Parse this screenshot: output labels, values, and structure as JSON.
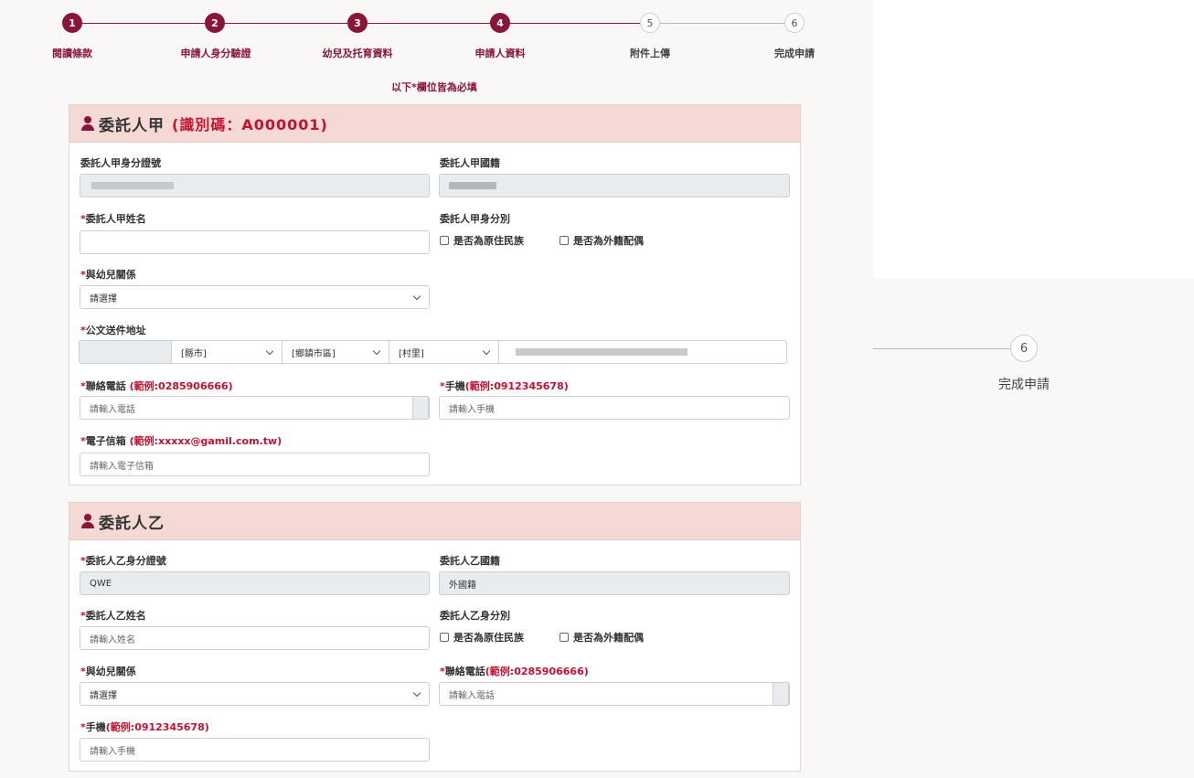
{
  "stepper": {
    "steps": [
      {
        "num": "1",
        "label": "閱讀條款"
      },
      {
        "num": "2",
        "label": "申請人身分驗證"
      },
      {
        "num": "3",
        "label": "幼兒及托育資料"
      },
      {
        "num": "4",
        "label": "申請人資料"
      },
      {
        "num": "5",
        "label": "附件上傳"
      },
      {
        "num": "6",
        "label": "完成申請"
      }
    ],
    "current_step": 4
  },
  "required_note": "以下*欄位皆為必填",
  "trustee_a": {
    "title": "委託人甲",
    "code": "(識別碼：A000001)",
    "id_label": "委託人甲身分證號",
    "nationality_label": "委託人甲國籍",
    "name_star": "*",
    "name_label": "委託人甲姓名",
    "name_value": "",
    "identity_label": "委託人甲身分別",
    "indigenous_label": "是否為原住民族",
    "foreign_spouse_label": "是否為外籍配偶",
    "relation_star": "*",
    "relation_label": "與幼兒關係",
    "relation_value": "請選擇",
    "address_star": "*",
    "address_label": "公文送件地址",
    "county_value": "[縣市]",
    "township_value": "[鄉鎮市區]",
    "village_value": "[村里]",
    "phone_star": "*",
    "phone_label": "聯絡電話",
    "phone_example": "(範例:0285906666)",
    "phone_placeholder": "請輸入電話",
    "mobile_star": "*",
    "mobile_label": "手機",
    "mobile_example": "(範例:0912345678)",
    "mobile_placeholder": "請輸入手機",
    "email_star": "*",
    "email_label": "電子信箱",
    "email_example": "(範例:xxxxx@gamil.com.tw)",
    "email_placeholder": "請輸入電子信箱"
  },
  "trustee_b": {
    "title": "委託人乙",
    "id_star": "*",
    "id_label": "委託人乙身分證號",
    "id_value": "QWE",
    "nationality_label": "委託人乙國籍",
    "nationality_value": "外國籍",
    "name_star": "*",
    "name_label": "委託人乙姓名",
    "name_placeholder": "請輸入姓名",
    "identity_label": "委託人乙身分別",
    "indigenous_label": "是否為原住民族",
    "foreign_spouse_label": "是否為外籍配偶",
    "relation_star": "*",
    "relation_label": "與幼兒關係",
    "relation_value": "請選擇",
    "phone_star": "*",
    "phone_label": "聯絡電話",
    "phone_example": "(範例:0285906666)",
    "phone_placeholder": "請輸入電話",
    "mobile_star": "*",
    "mobile_label": "手機",
    "mobile_example": "(範例:0912345678)",
    "mobile_placeholder": "請輸入手機"
  },
  "overlay_step": {
    "num": "6",
    "label": "完成申請"
  },
  "colors": {
    "primary": "#8a1538",
    "header_bg": "#f5d9d4",
    "required": "#c8102e"
  }
}
